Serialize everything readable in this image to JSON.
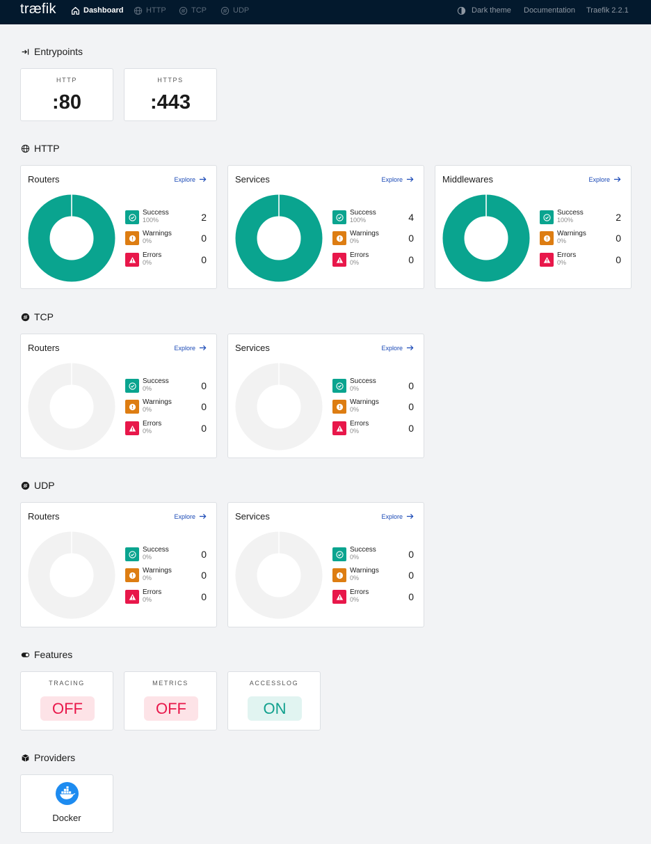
{
  "app": {
    "logo": "træfik"
  },
  "nav": {
    "dashboard": "Dashboard",
    "http": "HTTP",
    "tcp": "TCP",
    "udp": "UDP",
    "theme": "Dark theme",
    "docs": "Documentation",
    "version": "Traefik 2.2.1"
  },
  "entrypoints": {
    "title": "Entrypoints",
    "items": [
      {
        "name": "HTTP",
        "value": ":80"
      },
      {
        "name": "HTTPS",
        "value": ":443"
      }
    ]
  },
  "labels": {
    "explore": "Explore",
    "success": "Success",
    "warnings": "Warnings",
    "errors": "Errors"
  },
  "http": {
    "title": "HTTP",
    "routers": {
      "title": "Routers",
      "success": 2,
      "success_pct": "100%",
      "warnings": 0,
      "warnings_pct": "0%",
      "errors": 0,
      "errors_pct": "0%"
    },
    "services": {
      "title": "Services",
      "success": 4,
      "success_pct": "100%",
      "warnings": 0,
      "warnings_pct": "0%",
      "errors": 0,
      "errors_pct": "0%"
    },
    "middlewares": {
      "title": "Middlewares",
      "success": 2,
      "success_pct": "100%",
      "warnings": 0,
      "warnings_pct": "0%",
      "errors": 0,
      "errors_pct": "0%"
    }
  },
  "tcp": {
    "title": "TCP",
    "routers": {
      "title": "Routers",
      "success": 0,
      "success_pct": "0%",
      "warnings": 0,
      "warnings_pct": "0%",
      "errors": 0,
      "errors_pct": "0%"
    },
    "services": {
      "title": "Services",
      "success": 0,
      "success_pct": "0%",
      "warnings": 0,
      "warnings_pct": "0%",
      "errors": 0,
      "errors_pct": "0%"
    }
  },
  "udp": {
    "title": "UDP",
    "routers": {
      "title": "Routers",
      "success": 0,
      "success_pct": "0%",
      "warnings": 0,
      "warnings_pct": "0%",
      "errors": 0,
      "errors_pct": "0%"
    },
    "services": {
      "title": "Services",
      "success": 0,
      "success_pct": "0%",
      "warnings": 0,
      "warnings_pct": "0%",
      "errors": 0,
      "errors_pct": "0%"
    }
  },
  "features": {
    "title": "Features",
    "items": [
      {
        "name": "TRACING",
        "state": "OFF"
      },
      {
        "name": "METRICS",
        "state": "OFF"
      },
      {
        "name": "ACCESSLOG",
        "state": "ON"
      }
    ]
  },
  "providers": {
    "title": "Providers",
    "items": [
      {
        "name": "Docker",
        "icon": "docker-icon"
      }
    ]
  },
  "colors": {
    "navbar": "#03192d",
    "success": "#0aa48f",
    "warning": "#dd7d12",
    "error": "#e8174a",
    "link": "#1a49b6",
    "empty_ring": "#f2f2f2"
  }
}
